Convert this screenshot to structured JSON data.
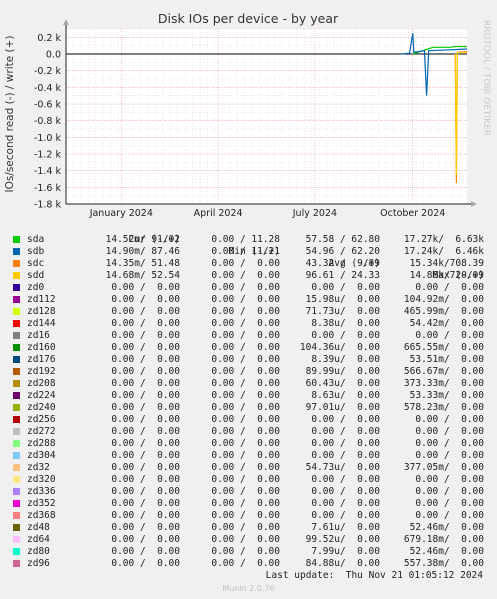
{
  "chart_data": {
    "type": "line",
    "title": "Disk IOs per device - by year",
    "ylabel": "IOs/second read (-) / write (+)",
    "watermark": "RRDTOOL / TOBI OETIKER",
    "ylim": [
      -1.8,
      0.3
    ],
    "y_ticks": [
      "0.2 k",
      "0.0",
      "-0.2 k",
      "-0.4 k",
      "-0.6 k",
      "-0.8 k",
      "-1.0 k",
      "-1.2 k",
      "-1.4 k",
      "-1.6 k",
      "-1.8 k"
    ],
    "y_tick_values": [
      0.2,
      0.0,
      -0.2,
      -0.4,
      -0.6,
      -0.8,
      -1.0,
      -1.2,
      -1.4,
      -1.6,
      -1.8
    ],
    "x_ticks": [
      "January 2024",
      "April 2024",
      "July 2024",
      "October 2024"
    ],
    "x_tick_dates": [
      "2024-01-01",
      "2024-04-01",
      "2024-07-01",
      "2024-10-01"
    ],
    "xlim": [
      "2023-11-10",
      "2024-11-21"
    ],
    "grid": true,
    "series": [
      {
        "name": "sda",
        "color": "#00cc00",
        "points": [
          [
            "2024-10-01",
            0.0
          ],
          [
            "2024-10-20",
            0.08
          ],
          [
            "2024-11-05",
            0.08
          ],
          [
            "2024-11-10",
            0.09
          ],
          [
            "2024-11-21",
            0.09
          ]
        ]
      },
      {
        "name": "sdb",
        "color": "#0066b3",
        "points": [
          [
            "2024-09-20",
            0.0
          ],
          [
            "2024-09-28",
            0.01
          ],
          [
            "2024-10-01",
            0.25
          ],
          [
            "2024-10-02",
            0.02
          ],
          [
            "2024-10-12",
            0.04
          ],
          [
            "2024-10-14",
            -0.5
          ],
          [
            "2024-10-16",
            0.04
          ],
          [
            "2024-11-05",
            0.05
          ],
          [
            "2024-11-21",
            0.06
          ]
        ]
      },
      {
        "name": "sdc",
        "color": "#ff8000",
        "points": [
          [
            "2024-11-10",
            0.0
          ],
          [
            "2024-11-11",
            -1.55
          ],
          [
            "2024-11-12",
            0.02
          ],
          [
            "2024-11-21",
            0.03
          ]
        ]
      },
      {
        "name": "sdd",
        "color": "#ffcc00",
        "points": [
          [
            "2024-11-10",
            0.0
          ],
          [
            "2024-11-11",
            -1.45
          ],
          [
            "2024-11-12",
            0.02
          ],
          [
            "2024-11-21",
            0.02
          ]
        ]
      },
      {
        "name": "zd0",
        "color": "#330099",
        "points": []
      },
      {
        "name": "zd112",
        "color": "#990099",
        "points": []
      },
      {
        "name": "zd128",
        "color": "#ccff00",
        "points": []
      },
      {
        "name": "zd144",
        "color": "#ff0000",
        "points": []
      },
      {
        "name": "zd16",
        "color": "#808080",
        "points": []
      },
      {
        "name": "zd160",
        "color": "#008f00",
        "points": []
      },
      {
        "name": "zd176",
        "color": "#00487d",
        "points": []
      },
      {
        "name": "zd192",
        "color": "#b35a00",
        "points": []
      },
      {
        "name": "zd208",
        "color": "#b38f00",
        "points": []
      },
      {
        "name": "zd224",
        "color": "#6b006b",
        "points": []
      },
      {
        "name": "zd240",
        "color": "#8fb300",
        "points": []
      },
      {
        "name": "zd256",
        "color": "#b30000",
        "points": []
      },
      {
        "name": "zd272",
        "color": "#bebebe",
        "points": []
      },
      {
        "name": "zd288",
        "color": "#80ff80",
        "points": []
      },
      {
        "name": "zd304",
        "color": "#80c9ff",
        "points": []
      },
      {
        "name": "zd32",
        "color": "#ffc080",
        "points": []
      },
      {
        "name": "zd320",
        "color": "#ffe680",
        "points": []
      },
      {
        "name": "zd336",
        "color": "#aa80ff",
        "points": []
      },
      {
        "name": "zd352",
        "color": "#ee00cc",
        "points": []
      },
      {
        "name": "zd368",
        "color": "#ff8080",
        "points": []
      },
      {
        "name": "zd48",
        "color": "#666600",
        "points": []
      },
      {
        "name": "zd64",
        "color": "#ffbfff",
        "points": []
      },
      {
        "name": "zd80",
        "color": "#00ffcc",
        "points": []
      },
      {
        "name": "zd96",
        "color": "#cc6699",
        "points": []
      }
    ]
  },
  "legend": {
    "headers": {
      "cur": "Cur (-/+)",
      "min": "Min (-/+)",
      "avg": "Avg (-/+)",
      "max": "Max (-/+)"
    },
    "rows": [
      {
        "name": "sda",
        "cur": "14.52m/ 91.02",
        "min": "0.00 / 11.28",
        "avg": "57.58 / 62.80",
        "max": "17.27k/  6.63k"
      },
      {
        "name": "sdb",
        "cur": "14.90m/ 87.46",
        "min": "0.00 / 11.21",
        "avg": "54.96 / 62.20",
        "max": "17.24k/  6.46k"
      },
      {
        "name": "sdc",
        "cur": "14.35m/ 51.48",
        "min": "0.00 /  0.00",
        "avg": "43.32 /  9.89",
        "max": "15.34k/708.39"
      },
      {
        "name": "sdd",
        "cur": "14.68m/ 52.54",
        "min": "0.00 /  0.00",
        "avg": "96.61 / 24.33",
        "max": "14.86k/720.09"
      },
      {
        "name": "zd0",
        "cur": "0.00 /  0.00",
        "min": "0.00 /  0.00",
        "avg": "0.00 /  0.00",
        "max": "0.00 /  0.00"
      },
      {
        "name": "zd112",
        "cur": "0.00 /  0.00",
        "min": "0.00 /  0.00",
        "avg": "15.98u/  0.00",
        "max": "104.92m/  0.00"
      },
      {
        "name": "zd128",
        "cur": "0.00 /  0.00",
        "min": "0.00 /  0.00",
        "avg": "71.73u/  0.00",
        "max": "465.99m/  0.00"
      },
      {
        "name": "zd144",
        "cur": "0.00 /  0.00",
        "min": "0.00 /  0.00",
        "avg": "8.38u/  0.00",
        "max": "54.42m/  0.00"
      },
      {
        "name": "zd16",
        "cur": "0.00 /  0.00",
        "min": "0.00 /  0.00",
        "avg": "0.00 /  0.00",
        "max": "0.00 /  0.00"
      },
      {
        "name": "zd160",
        "cur": "0.00 /  0.00",
        "min": "0.00 /  0.00",
        "avg": "104.36u/  0.00",
        "max": "665.55m/  0.00"
      },
      {
        "name": "zd176",
        "cur": "0.00 /  0.00",
        "min": "0.00 /  0.00",
        "avg": "8.39u/  0.00",
        "max": "53.51m/  0.00"
      },
      {
        "name": "zd192",
        "cur": "0.00 /  0.00",
        "min": "0.00 /  0.00",
        "avg": "89.99u/  0.00",
        "max": "566.67m/  0.00"
      },
      {
        "name": "zd208",
        "cur": "0.00 /  0.00",
        "min": "0.00 /  0.00",
        "avg": "60.43u/  0.00",
        "max": "373.33m/  0.00"
      },
      {
        "name": "zd224",
        "cur": "0.00 /  0.00",
        "min": "0.00 /  0.00",
        "avg": "8.63u/  0.00",
        "max": "53.33m/  0.00"
      },
      {
        "name": "zd240",
        "cur": "0.00 /  0.00",
        "min": "0.00 /  0.00",
        "avg": "97.01u/  0.00",
        "max": "578.23m/  0.00"
      },
      {
        "name": "zd256",
        "cur": "0.00 /  0.00",
        "min": "0.00 /  0.00",
        "avg": "0.00 /  0.00",
        "max": "0.00 /  0.00"
      },
      {
        "name": "zd272",
        "cur": "0.00 /  0.00",
        "min": "0.00 /  0.00",
        "avg": "0.00 /  0.00",
        "max": "0.00 /  0.00"
      },
      {
        "name": "zd288",
        "cur": "0.00 /  0.00",
        "min": "0.00 /  0.00",
        "avg": "0.00 /  0.00",
        "max": "0.00 /  0.00"
      },
      {
        "name": "zd304",
        "cur": "0.00 /  0.00",
        "min": "0.00 /  0.00",
        "avg": "0.00 /  0.00",
        "max": "0.00 /  0.00"
      },
      {
        "name": "zd32",
        "cur": "0.00 /  0.00",
        "min": "0.00 /  0.00",
        "avg": "54.73u/  0.00",
        "max": "377.05m/  0.00"
      },
      {
        "name": "zd320",
        "cur": "0.00 /  0.00",
        "min": "0.00 /  0.00",
        "avg": "0.00 /  0.00",
        "max": "0.00 /  0.00"
      },
      {
        "name": "zd336",
        "cur": "0.00 /  0.00",
        "min": "0.00 /  0.00",
        "avg": "0.00 /  0.00",
        "max": "0.00 /  0.00"
      },
      {
        "name": "zd352",
        "cur": "0.00 /  0.00",
        "min": "0.00 /  0.00",
        "avg": "0.00 /  0.00",
        "max": "0.00 /  0.00"
      },
      {
        "name": "zd368",
        "cur": "0.00 /  0.00",
        "min": "0.00 /  0.00",
        "avg": "0.00 /  0.00",
        "max": "0.00 /  0.00"
      },
      {
        "name": "zd48",
        "cur": "0.00 /  0.00",
        "min": "0.00 /  0.00",
        "avg": "7.61u/  0.00",
        "max": "52.46m/  0.00"
      },
      {
        "name": "zd64",
        "cur": "0.00 /  0.00",
        "min": "0.00 /  0.00",
        "avg": "99.52u/  0.00",
        "max": "679.18m/  0.00"
      },
      {
        "name": "zd80",
        "cur": "0.00 /  0.00",
        "min": "0.00 /  0.00",
        "avg": "7.99u/  0.00",
        "max": "52.46m/  0.00"
      },
      {
        "name": "zd96",
        "cur": "0.00 /  0.00",
        "min": "0.00 /  0.00",
        "avg": "84.88u/  0.00",
        "max": "557.38m/  0.00"
      }
    ]
  },
  "footer": {
    "last_update": "Last update:  Thu Nov 21 01:05:12 2024",
    "version": "Munin 2.0.76"
  }
}
